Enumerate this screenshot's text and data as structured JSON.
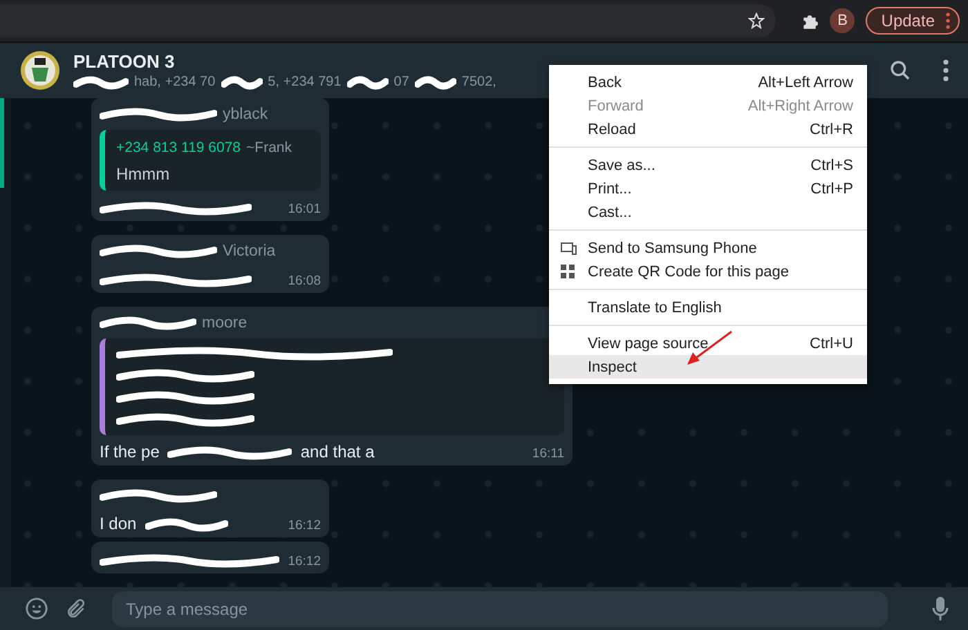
{
  "browser": {
    "profile_initial": "B",
    "update_button": "Update"
  },
  "chat_header": {
    "title": "PLATOON 3",
    "subtitle_fragments": [
      "hab, +234 70",
      "5, +234 791",
      "07",
      "7502,"
    ]
  },
  "messages": [
    {
      "kind": "reply",
      "sender_fragment": "yblack",
      "quote": {
        "sender": "+234 813 119 6078",
        "author": "~Frank",
        "text": "Hmmm",
        "color": "#06cf9c"
      },
      "time": "16:01"
    },
    {
      "kind": "plain",
      "sender_fragment": "Victoria",
      "time": "16:08"
    },
    {
      "kind": "long_reply",
      "sender_fragment": "moore",
      "quote": {
        "color": "#a97ce0"
      },
      "body_fragments": [
        "If the pe",
        "and that a"
      ],
      "time": "16:11"
    },
    {
      "kind": "plain",
      "body_fragments": [
        "I don"
      ],
      "time": "16:12"
    },
    {
      "kind": "followup",
      "time": "16:12"
    }
  ],
  "composer": {
    "placeholder": "Type a message"
  },
  "context_menu": {
    "groups": [
      [
        {
          "label": "Back",
          "shortcut": "Alt+Left Arrow",
          "disabled": false,
          "selected": false
        },
        {
          "label": "Forward",
          "shortcut": "Alt+Right Arrow",
          "disabled": true,
          "selected": false
        },
        {
          "label": "Reload",
          "shortcut": "Ctrl+R",
          "disabled": false,
          "selected": false
        }
      ],
      [
        {
          "label": "Save as...",
          "shortcut": "Ctrl+S",
          "disabled": false,
          "selected": false
        },
        {
          "label": "Print...",
          "shortcut": "Ctrl+P",
          "disabled": false,
          "selected": false
        },
        {
          "label": "Cast...",
          "disabled": false,
          "selected": false
        }
      ],
      [
        {
          "kind": "device",
          "label": "Send to Samsung Phone",
          "disabled": false,
          "selected": false
        },
        {
          "kind": "qr",
          "label": "Create QR Code for this page",
          "disabled": false,
          "selected": false
        }
      ],
      [
        {
          "label": "Translate to English",
          "disabled": false,
          "selected": false
        }
      ],
      [
        {
          "label": "View page source",
          "shortcut": "Ctrl+U",
          "disabled": false,
          "selected": false
        },
        {
          "label": "Inspect",
          "disabled": false,
          "selected": true
        }
      ]
    ]
  }
}
